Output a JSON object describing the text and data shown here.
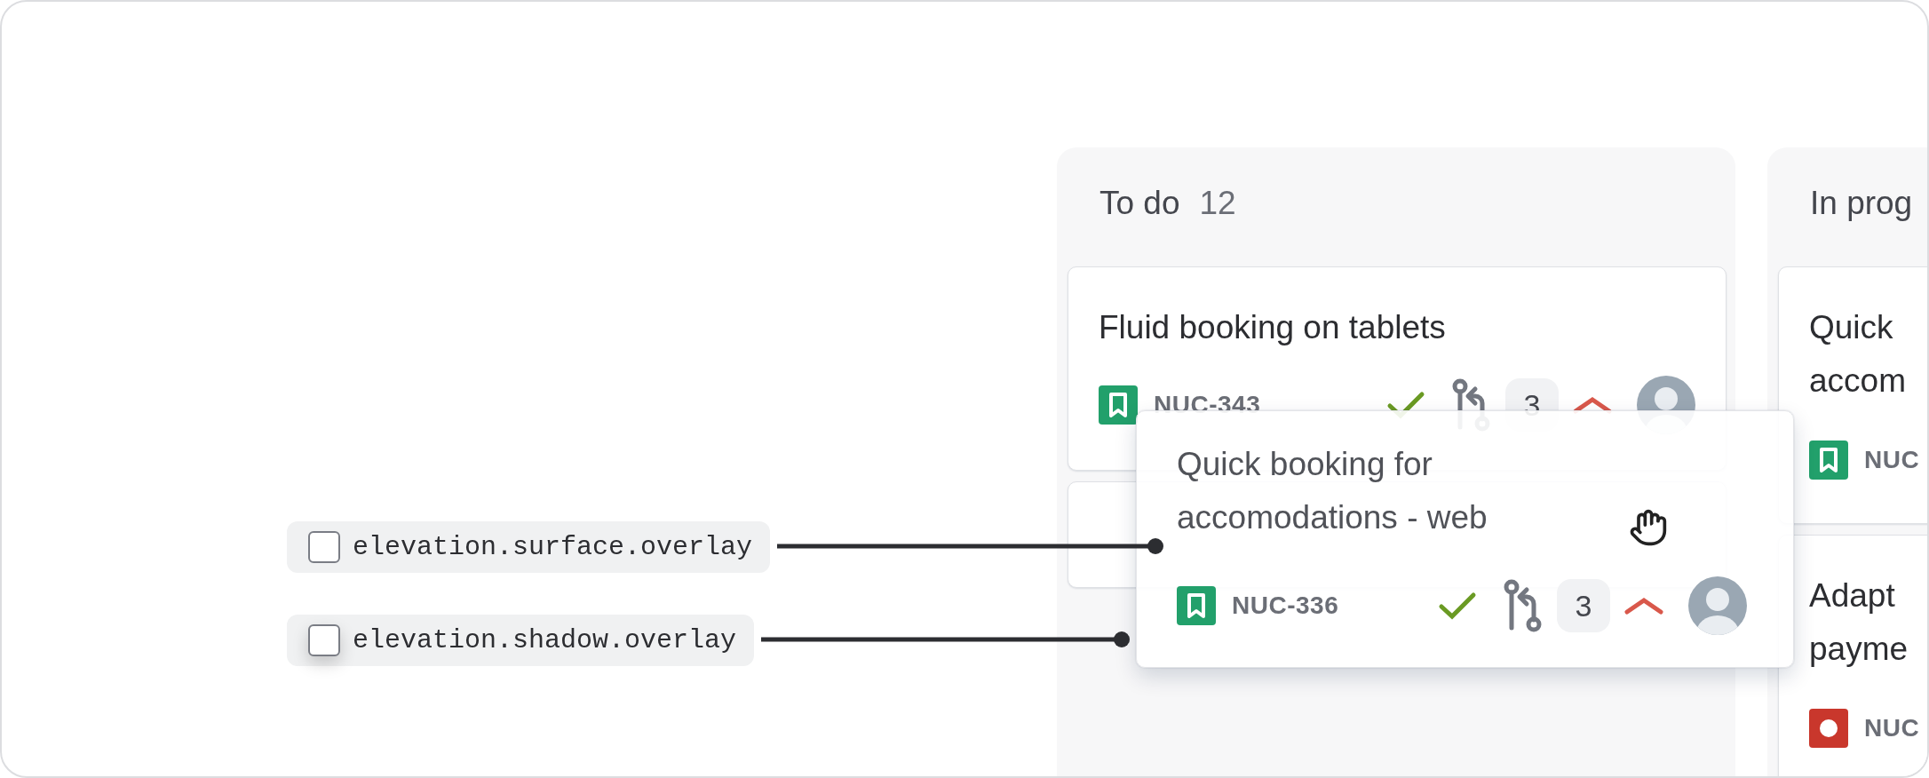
{
  "legend": [
    {
      "label": "elevation.surface.overlay",
      "checked": false,
      "shadow": false
    },
    {
      "label": "elevation.shadow.overlay",
      "checked": false,
      "shadow": true
    }
  ],
  "columns": [
    {
      "title": "To do",
      "count": "12",
      "cards": [
        {
          "kind": "full",
          "title": "Fluid booking on tablets",
          "key": "NUC-343",
          "issue_type": {
            "kind": "story"
          },
          "done": true,
          "pull_requests": "3",
          "priority": {
            "kind": "high"
          }
        },
        {
          "kind": "clipped"
        }
      ]
    },
    {
      "title": "In prog",
      "cards": [
        {
          "kind": "narrow",
          "title": "Quick accom",
          "key": "NUC",
          "issue_type": {
            "kind": "story"
          }
        },
        {
          "kind": "narrow",
          "title": "Adapt payme",
          "key": "NUC",
          "issue_type": {
            "kind": "bug"
          }
        }
      ]
    }
  ],
  "dragged_card": {
    "title": "Quick booking for accomodations - web",
    "key": "NUC-336",
    "issue_type": {
      "kind": "story"
    },
    "done": true,
    "pull_requests": "3",
    "priority": {
      "kind": "high"
    }
  }
}
